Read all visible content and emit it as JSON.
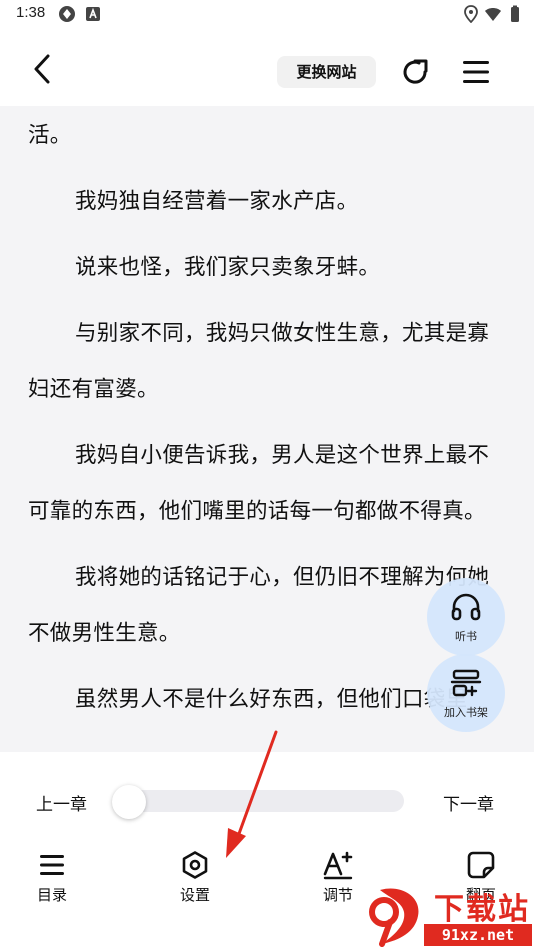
{
  "status_bar": {
    "time": "1:38"
  },
  "top_bar": {
    "change_site_label": "更换网站"
  },
  "reader": {
    "paragraphs": [
      "活。",
      "我妈独自经营着一家水产店。",
      "说来也怪，我们家只卖象牙蚌。",
      "与别家不同，我妈只做女性生意，尤其是寡妇还有富婆。",
      "我妈自小便告诉我，男人是这个世界上最不可靠的东西，他们嘴里的话每一句都做不得真。",
      "我将她的话铭记于心，但仍旧不理解为何她不做男性生意。",
      "虽然男人不是什么好东西，但他们口袋里"
    ]
  },
  "floating_buttons": {
    "listen_label": "听书",
    "add_shelf_label": "加入书架"
  },
  "progress": {
    "prev_label": "上一章",
    "next_label": "下一章",
    "value": 0
  },
  "toolbar": {
    "catalog_label": "目录",
    "settings_label": "设置",
    "adjust_label": "调节",
    "page_turn_label": "翻页"
  },
  "watermark": {
    "title": "下载站",
    "url": "91xz.net"
  },
  "colors": {
    "reader_bg": "#f4f4f6",
    "fab_bg": "#d4e6fc",
    "annotation": "#e02a20"
  }
}
